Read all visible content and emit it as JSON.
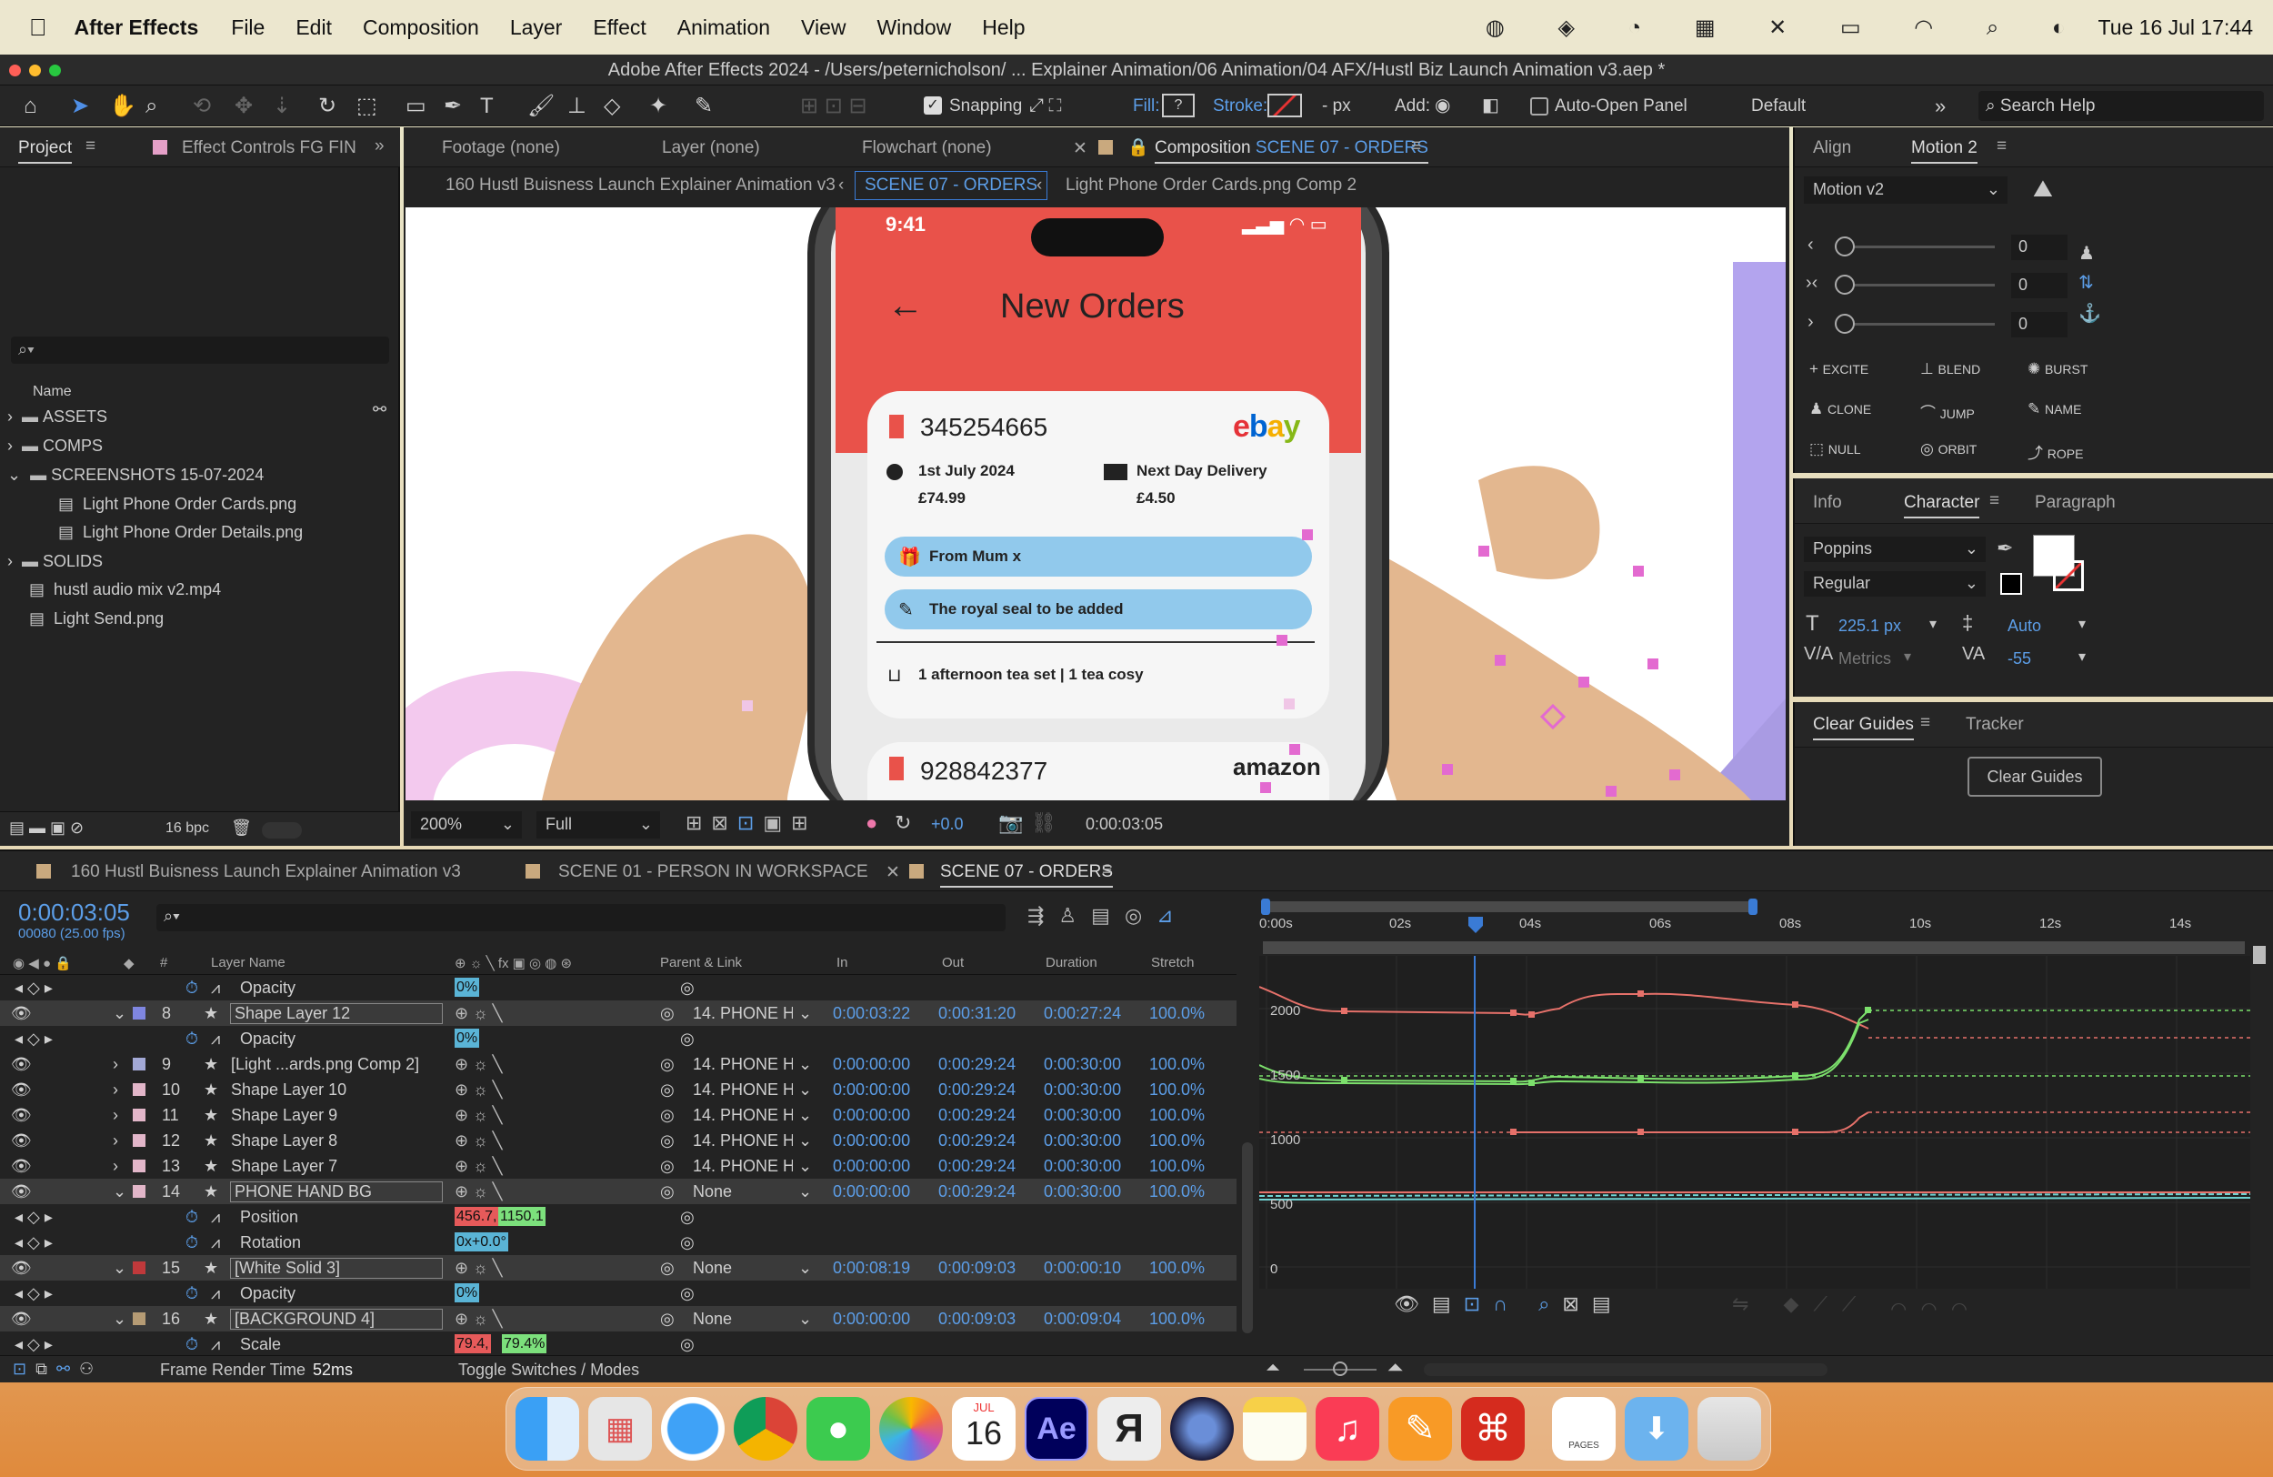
{
  "menubar": {
    "app": "After Effects",
    "items": [
      "File",
      "Edit",
      "Composition",
      "Layer",
      "Effect",
      "Animation",
      "View",
      "Window",
      "Help"
    ],
    "datetime": "Tue 16 Jul  17:44"
  },
  "window": {
    "title": "Adobe After Effects 2024 - /Users/peternicholson/ ... Explainer Animation/06 Animation/04 AFX/Hustl Biz Launch Animation v3.aep *"
  },
  "toolbar": {
    "snapping": "Snapping",
    "fill": "Fill:",
    "stroke": "Stroke:",
    "px": "- px",
    "add": "Add:",
    "auto_open": "Auto-Open Panel",
    "workspace": "Default",
    "search_help": "Search Help"
  },
  "project": {
    "tabs": [
      "Project",
      "Effect Controls FG FIN"
    ],
    "col_name": "Name",
    "items": [
      "ASSETS",
      "COMPS",
      "SCREENSHOTS 15-07-2024",
      "Light Phone Order Cards.png",
      "Light Phone Order Details.png",
      "SOLIDS",
      "hustl audio mix v2.mp4",
      "Light Send.png"
    ],
    "bpc": "16 bpc"
  },
  "viewer_tabs": {
    "footage": "Footage (none)",
    "layer": "Layer (none)",
    "flowchart": "Flowchart (none)",
    "composition": "Composition",
    "comp_name": "SCENE 07 - ORDERS",
    "crumb1": "160 Hustl Buisness Launch Explainer Animation v3",
    "crumb2": "SCENE 07 - ORDERS",
    "crumb3": "Light Phone Order Cards.png Comp 2"
  },
  "phone": {
    "time": "9:41",
    "header": "New Orders",
    "order1": {
      "id": "345254665",
      "brand": "ebay",
      "date": "1st July 2024",
      "price": "£74.99",
      "delivery": "Next Day Delivery",
      "delivery_price": "£4.50",
      "gift": "From Mum x",
      "note": "The royal seal to be added",
      "items": "1 afternoon tea set | 1 tea cosy"
    },
    "order2": {
      "id": "928842377",
      "brand": "amazon"
    }
  },
  "viewer_footer": {
    "zoom": "200%",
    "resolution": "Full",
    "exposure": "+0.0",
    "timecode": "0:00:03:05"
  },
  "right": {
    "tabs1": [
      "Align",
      "Motion 2"
    ],
    "motion_select": "Motion v2",
    "vals": [
      "0",
      "0",
      "0"
    ],
    "buttons": [
      "EXCITE",
      "BLEND",
      "BURST",
      "CLONE",
      "JUMP",
      "NAME",
      "NULL",
      "ORBIT",
      "ROPE"
    ],
    "tabs2": [
      "Info",
      "Character",
      "Paragraph"
    ],
    "font": "Poppins",
    "style": "Regular",
    "size": "225.1 px",
    "leading": "Auto",
    "kerning": "Metrics",
    "tracking": "-55",
    "tabs3": [
      "Clear Guides",
      "Tracker"
    ],
    "clear_btn": "Clear Guides"
  },
  "timeline": {
    "tabs": [
      "160 Hustl Buisness Launch Explainer Animation v3",
      "SCENE 01 - PERSON IN WORKSPACE",
      "SCENE 07 - ORDERS"
    ],
    "timecode": "0:00:03:05",
    "frames": "00080 (25.00 fps)",
    "headers": {
      "num": "#",
      "layer": "Layer Name",
      "parent": "Parent & Link",
      "in": "In",
      "out": "Out",
      "duration": "Duration",
      "stretch": "Stretch"
    },
    "rows": [
      {
        "type": "prop",
        "name": "Opacity",
        "val": "0%"
      },
      {
        "type": "layer",
        "num": "8",
        "name": "Shape Layer 12",
        "parent": "14. PHONE H/",
        "in": "0:00:03:22",
        "out": "0:00:31:20",
        "dur": "0:00:27:24",
        "stretch": "100.0%",
        "color": "#7f86e0"
      },
      {
        "type": "prop",
        "name": "Opacity",
        "val": "0%"
      },
      {
        "type": "layer",
        "num": "9",
        "name": "[Light ...ards.png Comp 2]",
        "parent": "14. PHONE H/",
        "in": "0:00:00:00",
        "out": "0:00:29:24",
        "dur": "0:00:30:00",
        "stretch": "100.0%",
        "color": "#a3a9d6"
      },
      {
        "type": "layer",
        "num": "10",
        "name": "Shape Layer 10",
        "parent": "14. PHONE H/",
        "in": "0:00:00:00",
        "out": "0:00:29:24",
        "dur": "0:00:30:00",
        "stretch": "100.0%",
        "color": "#e2b6c9"
      },
      {
        "type": "layer",
        "num": "11",
        "name": "Shape Layer 9",
        "parent": "14. PHONE H/",
        "in": "0:00:00:00",
        "out": "0:00:29:24",
        "dur": "0:00:30:00",
        "stretch": "100.0%",
        "color": "#e2b6c9"
      },
      {
        "type": "layer",
        "num": "12",
        "name": "Shape Layer 8",
        "parent": "14. PHONE H/",
        "in": "0:00:00:00",
        "out": "0:00:29:24",
        "dur": "0:00:30:00",
        "stretch": "100.0%",
        "color": "#e2b6c9"
      },
      {
        "type": "layer",
        "num": "13",
        "name": "Shape Layer 7",
        "parent": "14. PHONE H/",
        "in": "0:00:00:00",
        "out": "0:00:29:24",
        "dur": "0:00:30:00",
        "stretch": "100.0%",
        "color": "#e2b6c9"
      },
      {
        "type": "layer",
        "num": "14",
        "name": "PHONE HAND BG",
        "parent": "None",
        "in": "0:00:00:00",
        "out": "0:00:29:24",
        "dur": "0:00:30:00",
        "stretch": "100.0%",
        "color": "#e2b6c9"
      },
      {
        "type": "prop",
        "name": "Position",
        "val": "456.7,",
        "val2": "1150.1"
      },
      {
        "type": "prop",
        "name": "Rotation",
        "val": "0x+0.0°"
      },
      {
        "type": "layer",
        "num": "15",
        "name": "[White Solid 3]",
        "parent": "None",
        "in": "0:00:08:19",
        "out": "0:00:09:03",
        "dur": "0:00:00:10",
        "stretch": "100.0%",
        "color": "#c0393b"
      },
      {
        "type": "prop",
        "name": "Opacity",
        "val": "0%"
      },
      {
        "type": "layer",
        "num": "16",
        "name": "[BACKGROUND 4]",
        "parent": "None",
        "in": "0:00:00:00",
        "out": "0:00:09:03",
        "dur": "0:00:09:04",
        "stretch": "100.0%",
        "color": "#b59b74"
      },
      {
        "type": "prop",
        "name": "Scale",
        "val": "79.4,",
        "val2": "79.4%"
      }
    ],
    "ruler": [
      "0:00s",
      "02s",
      "04s",
      "06s",
      "08s",
      "10s",
      "12s",
      "14s"
    ],
    "graph_labels": [
      "2000",
      "1500",
      "1000",
      "500",
      "0"
    ],
    "frame_render": "Frame Render Time",
    "frame_ms": "52ms",
    "toggle": "Toggle Switches / Modes"
  },
  "dock": {
    "cal_month": "JUL",
    "cal_day": "16",
    "ae": "Ae",
    "pages": "PAGES"
  }
}
